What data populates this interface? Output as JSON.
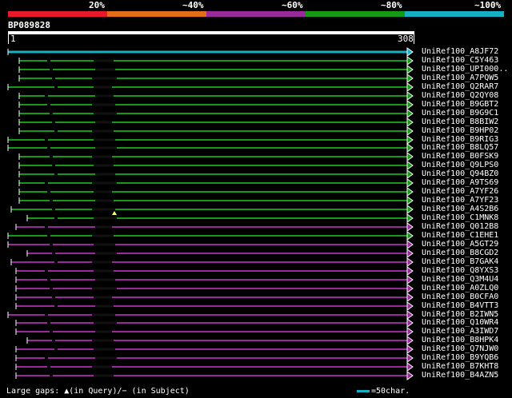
{
  "legend": {
    "items": [
      {
        "label": "20%",
        "color": "#e8192c"
      },
      {
        "label": "~40%",
        "color": "#e36d19"
      },
      {
        "label": "~60%",
        "color": "#9a2a9a"
      },
      {
        "label": "~80%",
        "color": "#169a16"
      },
      {
        "label": "~100%",
        "color": "#17b1c4"
      }
    ]
  },
  "query": {
    "id": "BP089828",
    "start": "1",
    "end": "308"
  },
  "hits": [
    {
      "name": "UniRef100_A8JF72",
      "color": "#17b1c4"
    },
    {
      "name": "UniRef100_C5Y463",
      "color": "#169a16"
    },
    {
      "name": "UniRef100_UPI000..",
      "color": "#169a16"
    },
    {
      "name": "UniRef100_A7PQW5",
      "color": "#169a16"
    },
    {
      "name": "UniRef100_Q2RAR7",
      "color": "#169a16"
    },
    {
      "name": "UniRef100_Q2QY08",
      "color": "#169a16"
    },
    {
      "name": "UniRef100_B9GBT2",
      "color": "#169a16"
    },
    {
      "name": "UniRef100_B9G9C1",
      "color": "#169a16"
    },
    {
      "name": "UniRef100_B8BIW2",
      "color": "#169a16"
    },
    {
      "name": "UniRef100_B9HP02",
      "color": "#169a16"
    },
    {
      "name": "UniRef100_B9RIG3",
      "color": "#169a16"
    },
    {
      "name": "UniRef100_B8LQ57",
      "color": "#169a16"
    },
    {
      "name": "UniRef100_B0FSK9",
      "color": "#169a16"
    },
    {
      "name": "UniRef100_Q9LPS0",
      "color": "#169a16"
    },
    {
      "name": "UniRef100_Q94BZ0",
      "color": "#169a16"
    },
    {
      "name": "UniRef100_A9TS69",
      "color": "#169a16"
    },
    {
      "name": "UniRef100_A7YF26",
      "color": "#169a16"
    },
    {
      "name": "UniRef100_A7YF23",
      "color": "#169a16"
    },
    {
      "name": "UniRef100_A4S2B6",
      "color": "#169a16"
    },
    {
      "name": "UniRef100_C1MNK8",
      "color": "#169a16"
    },
    {
      "name": "UniRef100_Q012B8",
      "color": "#9a2a9a"
    },
    {
      "name": "UniRef100_C1EHE1",
      "color": "#169a16"
    },
    {
      "name": "UniRef100_A5GT29",
      "color": "#9a2a9a"
    },
    {
      "name": "UniRef100_B8CGD2",
      "color": "#9a2a9a"
    },
    {
      "name": "UniRef100_B7GAK4",
      "color": "#9a2a9a"
    },
    {
      "name": "UniRef100_Q8YXS3",
      "color": "#9a2a9a"
    },
    {
      "name": "UniRef100_Q3M4U4",
      "color": "#9a2a9a"
    },
    {
      "name": "UniRef100_A0ZLQ0",
      "color": "#9a2a9a"
    },
    {
      "name": "UniRef100_B0CFA0",
      "color": "#9a2a9a"
    },
    {
      "name": "UniRef100_B4VTT3",
      "color": "#9a2a9a"
    },
    {
      "name": "UniRef100_B2IWN5",
      "color": "#9a2a9a"
    },
    {
      "name": "UniRef100_Q10WR4",
      "color": "#9a2a9a"
    },
    {
      "name": "UniRef100_A3IWD7",
      "color": "#9a2a9a"
    },
    {
      "name": "UniRef100_B8HPK4",
      "color": "#9a2a9a"
    },
    {
      "name": "UniRef100_Q7NJW0",
      "color": "#9a2a9a"
    },
    {
      "name": "UniRef100_B9YQB6",
      "color": "#9a2a9a"
    },
    {
      "name": "UniRef100_B7KHT8",
      "color": "#9a2a9a"
    },
    {
      "name": "UniRef100_B4AZN5",
      "color": "#9a2a9a"
    }
  ],
  "footer": {
    "gaps_text": "Large gaps: ▲(in Query)/− (in Subject)",
    "scale_text": "=50char."
  }
}
